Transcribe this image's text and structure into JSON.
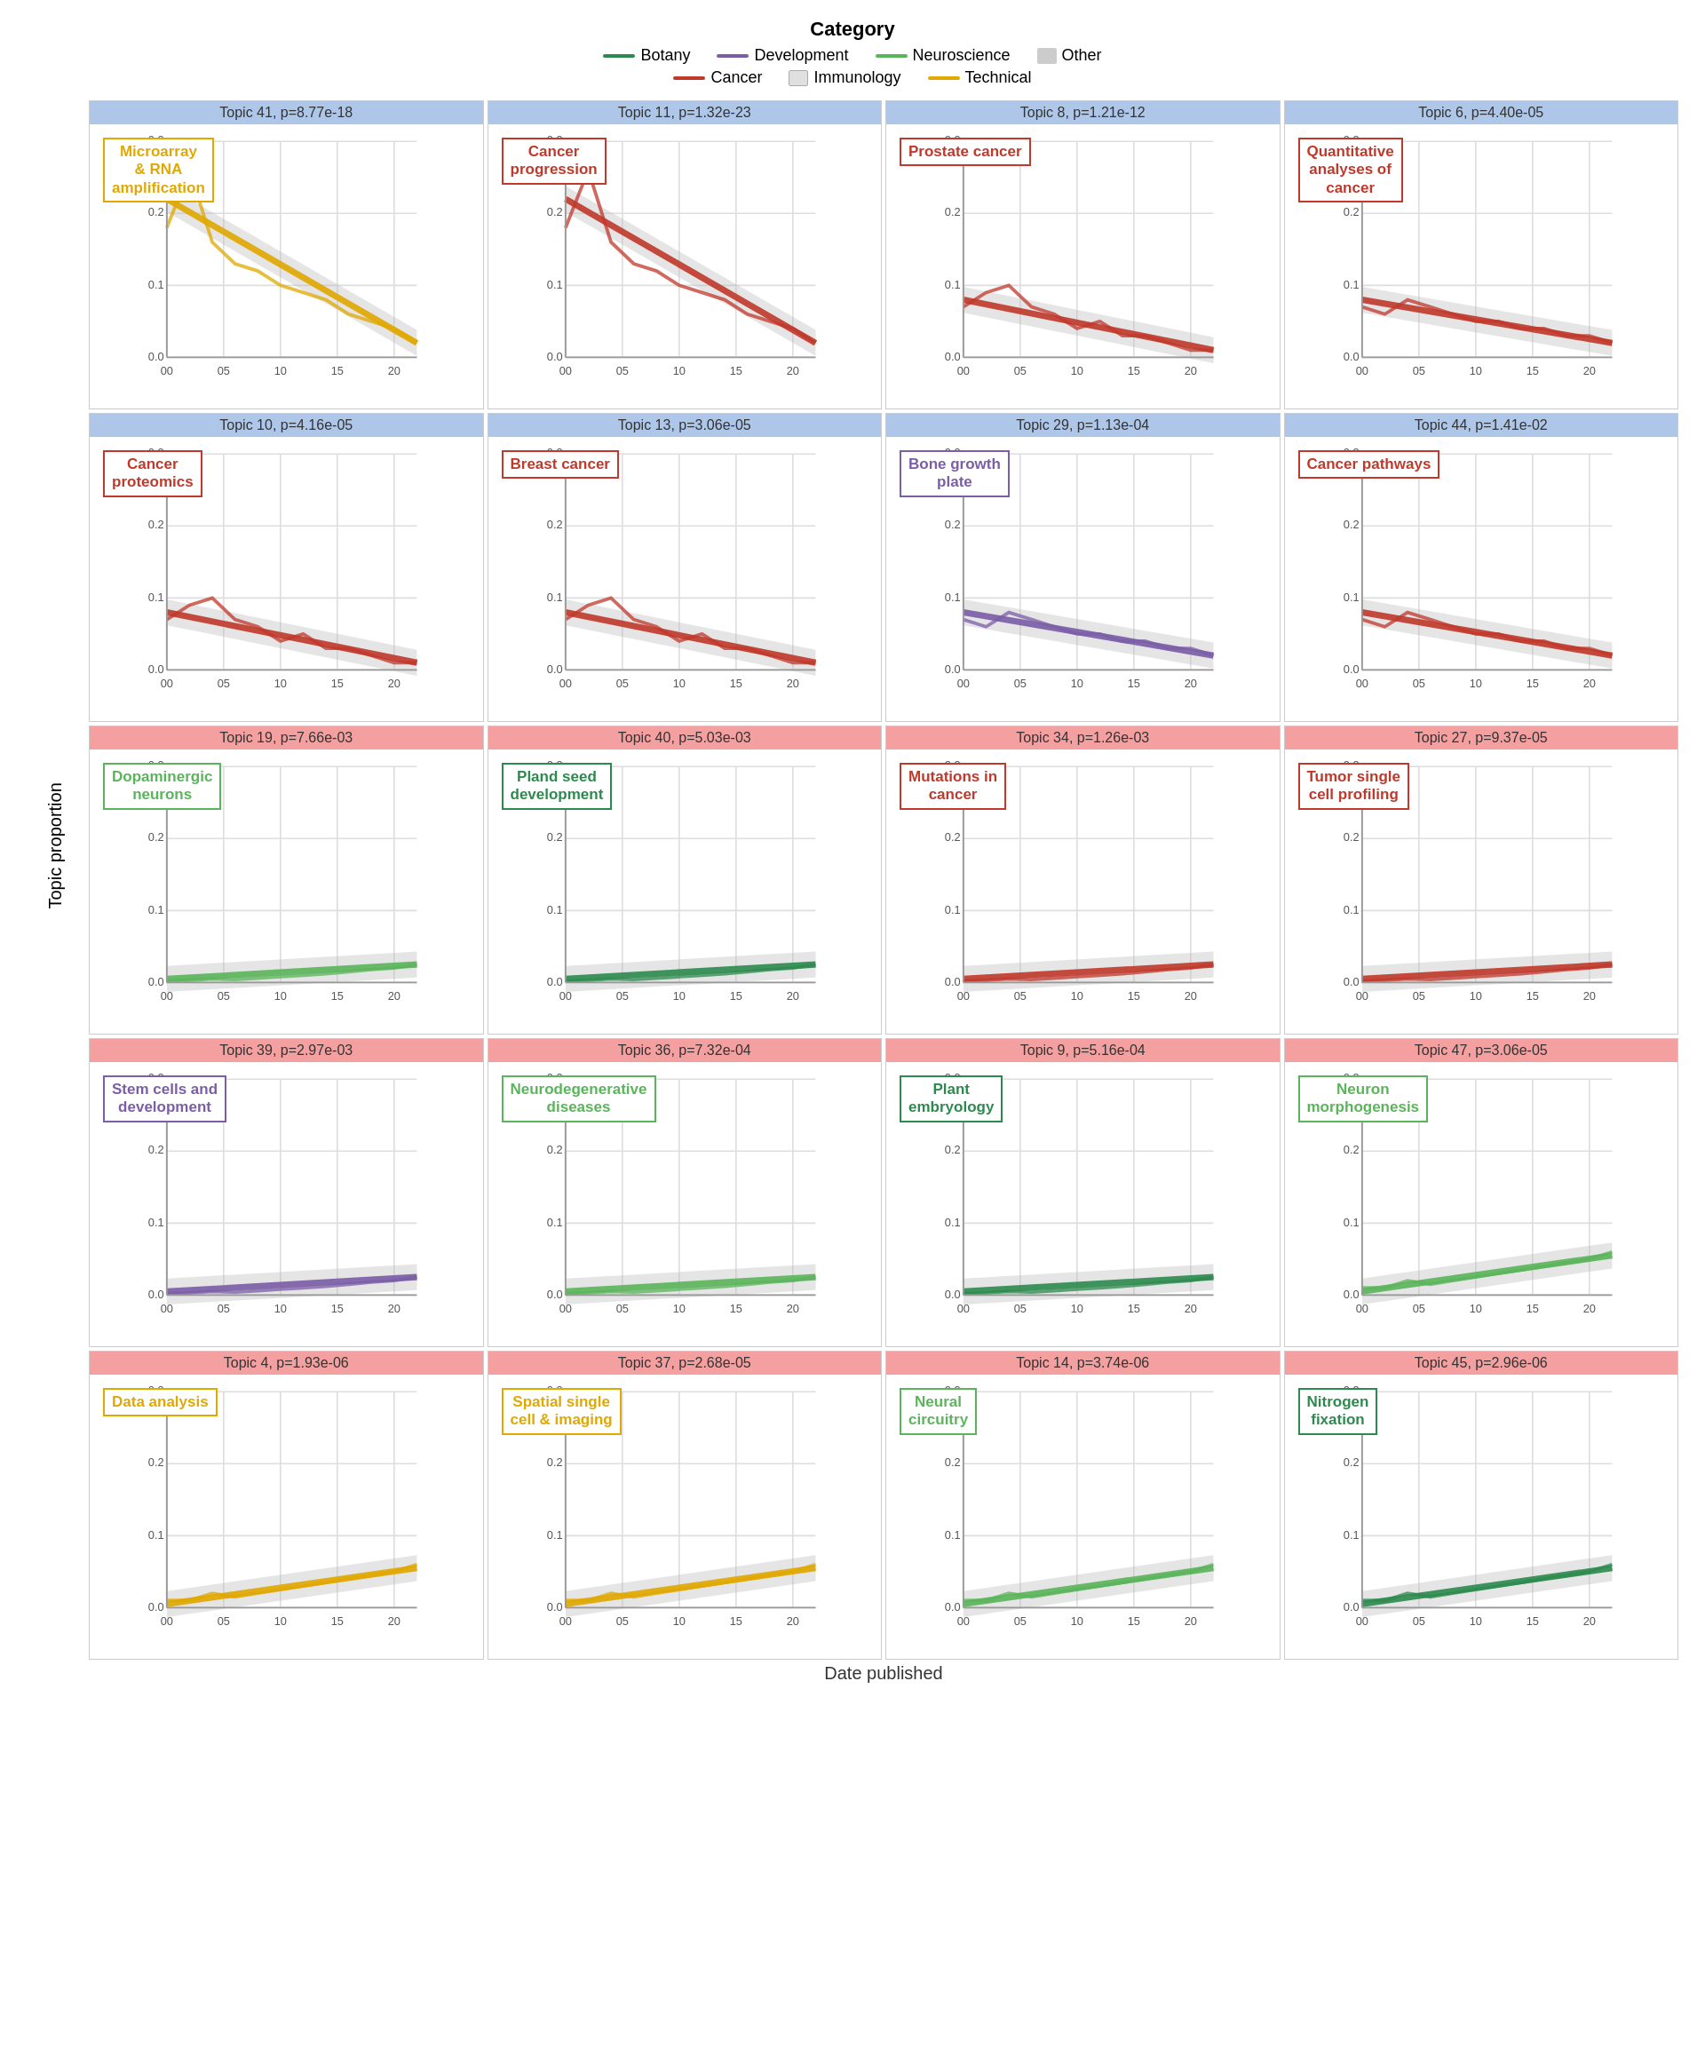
{
  "legend": {
    "title": "Category",
    "items": [
      {
        "label": "Botany",
        "color": "#2d8a4e",
        "type": "line"
      },
      {
        "label": "Development",
        "color": "#7b5ea7",
        "type": "line"
      },
      {
        "label": "Neuroscience",
        "color": "#5ab55a",
        "type": "line"
      },
      {
        "label": "Other",
        "color": "#cccccc",
        "type": "rect"
      },
      {
        "label": "Cancer",
        "color": "#c0392b",
        "type": "line"
      },
      {
        "label": "Immunology",
        "color": "#e0e0e0",
        "type": "rect"
      },
      {
        "label": "Technical",
        "color": "#e0a800",
        "type": "line"
      }
    ]
  },
  "y_axis_label": "Topic proportion",
  "x_axis_label": "Date published",
  "panels": [
    {
      "row": 0,
      "col": 0,
      "title": "Topic 41, p=8.77e-18",
      "title_bg": "blue",
      "label": "Microarray\n& RNA\namplification",
      "label_color": "#e0a800",
      "label_border": "#e0a800",
      "trend_color": "#e0a800",
      "line_color": "#e0a800",
      "has_grey_band": true,
      "ymax": 0.3,
      "trend_direction": "down_steep"
    },
    {
      "row": 0,
      "col": 1,
      "title": "Topic 11, p=1.32e-23",
      "title_bg": "blue",
      "label": "Cancer\nprogression",
      "label_color": "#c0392b",
      "label_border": "#c0392b",
      "trend_color": "#c0392b",
      "line_color": "#c0392b",
      "has_grey_band": true,
      "ymax": 0.3,
      "trend_direction": "down_steep"
    },
    {
      "row": 0,
      "col": 2,
      "title": "Topic 8, p=1.21e-12",
      "title_bg": "blue",
      "label": "Prostate cancer",
      "label_color": "#c0392b",
      "label_border": "#c0392b",
      "trend_color": "#c0392b",
      "line_color": "#c0392b",
      "has_grey_band": true,
      "ymax": 0.3,
      "trend_direction": "down_mid"
    },
    {
      "row": 0,
      "col": 3,
      "title": "Topic 6, p=4.40e-05",
      "title_bg": "blue",
      "label": "Quantitative\nanalyses of\ncancer",
      "label_color": "#c0392b",
      "label_border": "#c0392b",
      "trend_color": "#c0392b",
      "line_color": "#c0392b",
      "has_grey_band": true,
      "ymax": 0.3,
      "trend_direction": "down_gentle"
    },
    {
      "row": 1,
      "col": 0,
      "title": "Topic 10, p=4.16e-05",
      "title_bg": "blue",
      "label": "Cancer\nproteomics",
      "label_color": "#c0392b",
      "label_border": "#c0392b",
      "trend_color": "#c0392b",
      "line_color": "#c0392b",
      "has_grey_band": true,
      "ymax": 0.3,
      "trend_direction": "down_mid"
    },
    {
      "row": 1,
      "col": 1,
      "title": "Topic 13, p=3.06e-05",
      "title_bg": "blue",
      "label": "Breast cancer",
      "label_color": "#c0392b",
      "label_border": "#c0392b",
      "trend_color": "#c0392b",
      "line_color": "#c0392b",
      "has_grey_band": true,
      "ymax": 0.3,
      "trend_direction": "down_mid"
    },
    {
      "row": 1,
      "col": 2,
      "title": "Topic 29, p=1.13e-04",
      "title_bg": "blue",
      "label": "Bone growth\nplate",
      "label_color": "#7b5ea7",
      "label_border": "#7b5ea7",
      "trend_color": "#7b5ea7",
      "line_color": "#7b5ea7",
      "has_grey_band": true,
      "ymax": 0.3,
      "trend_direction": "down_gentle"
    },
    {
      "row": 1,
      "col": 3,
      "title": "Topic 44, p=1.41e-02",
      "title_bg": "blue",
      "label": "Cancer pathways",
      "label_color": "#c0392b",
      "label_border": "#c0392b",
      "trend_color": "#c0392b",
      "line_color": "#c0392b",
      "has_grey_band": true,
      "ymax": 0.3,
      "trend_direction": "down_gentle"
    },
    {
      "row": 2,
      "col": 0,
      "title": "Topic 19, p=7.66e-03",
      "title_bg": "red",
      "label": "Dopaminergic\nneurons",
      "label_color": "#5ab55a",
      "label_border": "#5ab55a",
      "trend_color": "#5ab55a",
      "line_color": "#5ab55a",
      "has_grey_band": true,
      "ymax": 0.3,
      "trend_direction": "up_gentle"
    },
    {
      "row": 2,
      "col": 1,
      "title": "Topic 40, p=5.03e-03",
      "title_bg": "red",
      "label": "Pland seed\ndevelopment",
      "label_color": "#2d8a4e",
      "label_border": "#2d8a4e",
      "trend_color": "#2d8a4e",
      "line_color": "#2d8a4e",
      "has_grey_band": true,
      "ymax": 0.3,
      "trend_direction": "up_gentle"
    },
    {
      "row": 2,
      "col": 2,
      "title": "Topic 34, p=1.26e-03",
      "title_bg": "red",
      "label": "Mutations in\ncancer",
      "label_color": "#c0392b",
      "label_border": "#c0392b",
      "trend_color": "#c0392b",
      "line_color": "#c0392b",
      "has_grey_band": true,
      "ymax": 0.3,
      "trend_direction": "up_gentle"
    },
    {
      "row": 2,
      "col": 3,
      "title": "Topic 27, p=9.37e-05",
      "title_bg": "red",
      "label": "Tumor single\ncell profiling",
      "label_color": "#c0392b",
      "label_border": "#c0392b",
      "trend_color": "#c0392b",
      "line_color": "#c0392b",
      "has_grey_band": true,
      "ymax": 0.3,
      "trend_direction": "up_gentle"
    },
    {
      "row": 3,
      "col": 0,
      "title": "Topic 39, p=2.97e-03",
      "title_bg": "red",
      "label": "Stem cells and\ndevelopment",
      "label_color": "#7b5ea7",
      "label_border": "#7b5ea7",
      "trend_color": "#7b5ea7",
      "line_color": "#7b5ea7",
      "has_grey_band": true,
      "ymax": 0.3,
      "trend_direction": "up_gentle"
    },
    {
      "row": 3,
      "col": 1,
      "title": "Topic 36, p=7.32e-04",
      "title_bg": "red",
      "label": "Neurodegenerative\ndiseases",
      "label_color": "#5ab55a",
      "label_border": "#5ab55a",
      "trend_color": "#5ab55a",
      "line_color": "#5ab55a",
      "has_grey_band": true,
      "ymax": 0.3,
      "trend_direction": "up_gentle"
    },
    {
      "row": 3,
      "col": 2,
      "title": "Topic 9, p=5.16e-04",
      "title_bg": "red",
      "label": "Plant\nembryology",
      "label_color": "#2d8a4e",
      "label_border": "#2d8a4e",
      "trend_color": "#2d8a4e",
      "line_color": "#2d8a4e",
      "has_grey_band": true,
      "ymax": 0.3,
      "trend_direction": "up_gentle"
    },
    {
      "row": 3,
      "col": 3,
      "title": "Topic 47, p=3.06e-05",
      "title_bg": "red",
      "label": "Neuron\nmorphogenesis",
      "label_color": "#5ab55a",
      "label_border": "#5ab55a",
      "trend_color": "#5ab55a",
      "line_color": "#5ab55a",
      "has_grey_band": true,
      "ymax": 0.3,
      "trend_direction": "up_mid"
    },
    {
      "row": 4,
      "col": 0,
      "title": "Topic 4, p=1.93e-06",
      "title_bg": "red",
      "label": "Data analysis",
      "label_color": "#e0a800",
      "label_border": "#e0a800",
      "trend_color": "#e0a800",
      "line_color": "#e0a800",
      "has_grey_band": true,
      "ymax": 0.3,
      "trend_direction": "up_mid"
    },
    {
      "row": 4,
      "col": 1,
      "title": "Topic 37, p=2.68e-05",
      "title_bg": "red",
      "label": "Spatial single\ncell & imaging",
      "label_color": "#e0a800",
      "label_border": "#e0a800",
      "trend_color": "#e0a800",
      "line_color": "#e0a800",
      "has_grey_band": true,
      "ymax": 0.3,
      "trend_direction": "up_mid"
    },
    {
      "row": 4,
      "col": 2,
      "title": "Topic 14, p=3.74e-06",
      "title_bg": "red",
      "label": "Neural\ncircuitry",
      "label_color": "#5ab55a",
      "label_border": "#5ab55a",
      "trend_color": "#5ab55a",
      "line_color": "#5ab55a",
      "has_grey_band": true,
      "ymax": 0.3,
      "trend_direction": "up_mid"
    },
    {
      "row": 4,
      "col": 3,
      "title": "Topic 45, p=2.96e-06",
      "title_bg": "red",
      "label": "Nitrogen\nfixation",
      "label_color": "#2d8a4e",
      "label_border": "#2d8a4e",
      "trend_color": "#2d8a4e",
      "line_color": "#2d8a4e",
      "has_grey_band": true,
      "ymax": 0.3,
      "trend_direction": "up_mid"
    }
  ]
}
